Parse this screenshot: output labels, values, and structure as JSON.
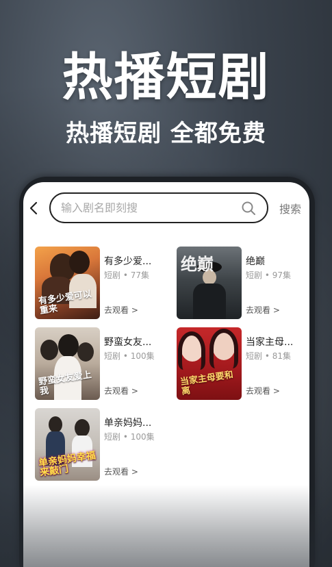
{
  "hero": {
    "title": "热播短剧",
    "subtitle": "热播短剧 全都免费"
  },
  "search": {
    "placeholder": "输入剧名即刻搜",
    "button_label": "搜索"
  },
  "dramas": [
    {
      "title": "有多少爱...",
      "meta": "短剧 • 77集",
      "link": "去观看 >",
      "poster_text": "有多少爱可以重来"
    },
    {
      "title": "绝巅",
      "meta": "短剧 • 97集",
      "link": "去观看 >",
      "poster_text": "绝巅"
    },
    {
      "title": "野蛮女友...",
      "meta": "短剧 • 100集",
      "link": "去观看 >",
      "poster_text": "野蛮女友爱上我"
    },
    {
      "title": "当家主母...",
      "meta": "短剧 • 81集",
      "link": "去观看 >",
      "poster_text": "当家主母要和离"
    },
    {
      "title": "单亲妈妈...",
      "meta": "短剧 • 100集",
      "link": "去观看 >",
      "poster_text": "单亲妈妈幸福来敲门"
    }
  ],
  "colors": {
    "background": "#3a424c",
    "accent_text": "#ffffff"
  }
}
